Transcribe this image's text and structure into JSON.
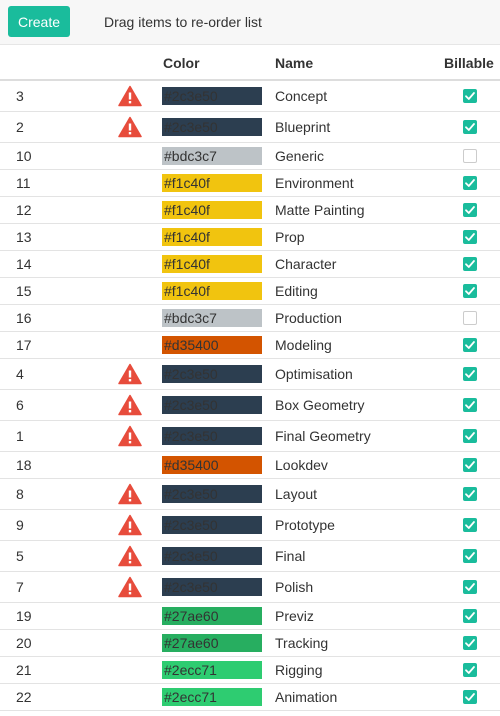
{
  "toolbar": {
    "create_label": "Create",
    "hint": "Drag items to re-order list"
  },
  "headers": {
    "color": "Color",
    "name": "Name",
    "billable": "Billable"
  },
  "colors": {
    "accent": "#1abc9c",
    "warning": "#e74c3c"
  },
  "rows": [
    {
      "id": "3",
      "warn": true,
      "color": "#2c3e50",
      "color_text": "#2c3e50",
      "name": "Concept",
      "billable": true,
      "tall": true
    },
    {
      "id": "2",
      "warn": true,
      "color": "#2c3e50",
      "color_text": "#2c3e50",
      "name": "Blueprint",
      "billable": true,
      "tall": true
    },
    {
      "id": "10",
      "warn": false,
      "color": "#bdc3c7",
      "color_text": "#bdc3c7",
      "name": "Generic",
      "billable": false,
      "tall": false
    },
    {
      "id": "11",
      "warn": false,
      "color": "#f1c40f",
      "color_text": "#f1c40f",
      "name": "Environment",
      "billable": true,
      "tall": false
    },
    {
      "id": "12",
      "warn": false,
      "color": "#f1c40f",
      "color_text": "#f1c40f",
      "name": "Matte Painting",
      "billable": true,
      "tall": false
    },
    {
      "id": "13",
      "warn": false,
      "color": "#f1c40f",
      "color_text": "#f1c40f",
      "name": "Prop",
      "billable": true,
      "tall": false
    },
    {
      "id": "14",
      "warn": false,
      "color": "#f1c40f",
      "color_text": "#f1c40f",
      "name": "Character",
      "billable": true,
      "tall": false
    },
    {
      "id": "15",
      "warn": false,
      "color": "#f1c40f",
      "color_text": "#f1c40f",
      "name": "Editing",
      "billable": true,
      "tall": false
    },
    {
      "id": "16",
      "warn": false,
      "color": "#bdc3c7",
      "color_text": "#bdc3c7",
      "name": "Production",
      "billable": false,
      "tall": false
    },
    {
      "id": "17",
      "warn": false,
      "color": "#d35400",
      "color_text": "#d35400",
      "name": "Modeling",
      "billable": true,
      "tall": false
    },
    {
      "id": "4",
      "warn": true,
      "color": "#2c3e50",
      "color_text": "#2c3e50",
      "name": "Optimisation",
      "billable": true,
      "tall": true
    },
    {
      "id": "6",
      "warn": true,
      "color": "#2c3e50",
      "color_text": "#2c3e50",
      "name": "Box Geometry",
      "billable": true,
      "tall": true
    },
    {
      "id": "1",
      "warn": true,
      "color": "#2c3e50",
      "color_text": "#2c3e50",
      "name": "Final Geometry",
      "billable": true,
      "tall": true
    },
    {
      "id": "18",
      "warn": false,
      "color": "#d35400",
      "color_text": "#d35400",
      "name": "Lookdev",
      "billable": true,
      "tall": false
    },
    {
      "id": "8",
      "warn": true,
      "color": "#2c3e50",
      "color_text": "#2c3e50",
      "name": "Layout",
      "billable": true,
      "tall": true
    },
    {
      "id": "9",
      "warn": true,
      "color": "#2c3e50",
      "color_text": "#2c3e50",
      "name": "Prototype",
      "billable": true,
      "tall": true
    },
    {
      "id": "5",
      "warn": true,
      "color": "#2c3e50",
      "color_text": "#2c3e50",
      "name": "Final",
      "billable": true,
      "tall": true
    },
    {
      "id": "7",
      "warn": true,
      "color": "#2c3e50",
      "color_text": "#2c3e50",
      "name": "Polish",
      "billable": true,
      "tall": true
    },
    {
      "id": "19",
      "warn": false,
      "color": "#27ae60",
      "color_text": "#27ae60",
      "name": "Previz",
      "billable": true,
      "tall": false
    },
    {
      "id": "20",
      "warn": false,
      "color": "#27ae60",
      "color_text": "#27ae60",
      "name": "Tracking",
      "billable": true,
      "tall": false
    },
    {
      "id": "21",
      "warn": false,
      "color": "#2ecc71",
      "color_text": "#2ecc71",
      "name": "Rigging",
      "billable": true,
      "tall": false
    },
    {
      "id": "22",
      "warn": false,
      "color": "#2ecc71",
      "color_text": "#2ecc71",
      "name": "Animation",
      "billable": true,
      "tall": false
    }
  ]
}
